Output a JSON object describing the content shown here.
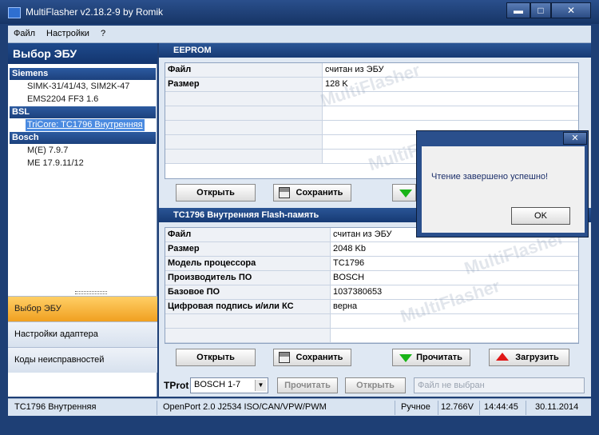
{
  "window": {
    "title": "MultiFlasher v2.18.2-9 by Romik",
    "minimize": "▬",
    "maximize": "□",
    "close": "✕"
  },
  "menu": [
    "Файл",
    "Настройки",
    "?"
  ],
  "sidebar": {
    "header": "Выбор ЭБУ",
    "groups": [
      {
        "name": "Siemens",
        "items": [
          "SIMK-31/41/43, SIM2K-47",
          "EMS2204 FF3 1.6"
        ]
      },
      {
        "name": "BSL",
        "items": [
          "TriCore: TC1796 Внутренняя"
        ]
      },
      {
        "name": "Bosch",
        "items": [
          "M(E) 7.9.7",
          "ME 17.9.11/12"
        ]
      }
    ],
    "selected_item": "TriCore: TC1796 Внутренняя",
    "nav": [
      "Выбор ЭБУ",
      "Настройки адаптера",
      "Коды неисправностей"
    ],
    "active_nav": "Выбор ЭБУ"
  },
  "eeprom": {
    "header": "EEPROM",
    "rows": [
      {
        "k": "Файл",
        "v": "считан из ЭБУ"
      },
      {
        "k": "Размер",
        "v": "128 K"
      },
      {
        "k": "",
        "v": ""
      },
      {
        "k": "",
        "v": ""
      },
      {
        "k": "",
        "v": ""
      },
      {
        "k": "",
        "v": ""
      },
      {
        "k": "",
        "v": ""
      }
    ],
    "buttons": {
      "open": "Открыть",
      "save": "Сохранить"
    }
  },
  "flash": {
    "header": "TC1796 Внутренняя Flash-память",
    "rows": [
      {
        "k": "Файл",
        "v": "считан из ЭБУ"
      },
      {
        "k": "Размер",
        "v": "2048 Kb"
      },
      {
        "k": "Модель процессора",
        "v": "TC1796"
      },
      {
        "k": "Производитель ПО",
        "v": "BOSCH"
      },
      {
        "k": "Базовое ПО",
        "v": "1037380653"
      },
      {
        "k": "Цифровая подпись и/или КС",
        "v": "верна"
      },
      {
        "k": "",
        "v": ""
      },
      {
        "k": "",
        "v": ""
      }
    ],
    "buttons": {
      "open": "Открыть",
      "save": "Сохранить",
      "read": "Прочитать",
      "write": "Загрузить"
    }
  },
  "tprot": {
    "label": "TProt",
    "value": "BOSCH 1-7",
    "read": "Прочитать",
    "open": "Открыть",
    "file_placeholder": "Файл не выбран"
  },
  "status": {
    "ecu": "TC1796 Внутренняя",
    "adapter": "OpenPort 2.0 J2534 ISO/CAN/VPW/PWM",
    "mode": "Ручное",
    "voltage": "12.766V",
    "time": "14:44:45",
    "date": "30.11.2014"
  },
  "dialog": {
    "message": "Чтение завершено успешно!",
    "ok": "OK",
    "close": "✕"
  }
}
